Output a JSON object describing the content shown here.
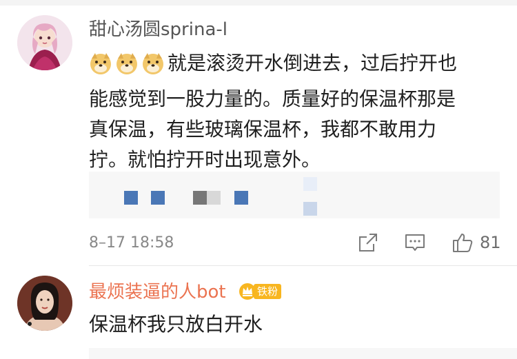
{
  "comment1": {
    "username": "甜心汤圆sprina-l",
    "emojis": [
      "doge-emoji",
      "doge-emoji",
      "doge-emoji"
    ],
    "lines": [
      "就是滚烫开水倒进去，过后拧开也",
      "能感觉到一股力量的。质量好的保温杯那是",
      "真保温，有些玻璃保温杯，我都不敢用力",
      "拧。就怕拧开时出现意外。"
    ],
    "timestamp": "8–17 18:58",
    "like_count": "81",
    "icons": [
      "share-icon",
      "comment-icon",
      "thumbs-up-icon"
    ]
  },
  "comment2": {
    "username": "最烦装逼的人bot",
    "badge": {
      "label": "铁粉",
      "icon": "crown-icon",
      "color": "#f8b620"
    },
    "text": "保温杯我只放白开水"
  },
  "colors": {
    "username_highlight": "#eb7350",
    "username_normal": "#555555",
    "meta_gray": "#888888"
  }
}
